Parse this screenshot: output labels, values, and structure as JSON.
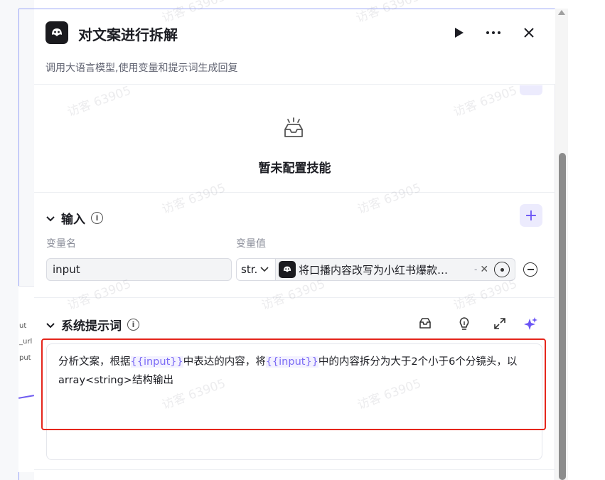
{
  "node": {
    "title": "对文案进行拆解",
    "description": "调用大语言模型,使用变量和提示词生成回复"
  },
  "skills": {
    "empty_text": "暂未配置技能"
  },
  "input_section": {
    "title": "输入",
    "col_name": "变量名",
    "col_value": "变量值",
    "rows": [
      {
        "name": "input",
        "type": "str.",
        "ref": "将口播内容改写为小红书爆款…",
        "ref_suffix": "-"
      }
    ]
  },
  "system_prompt": {
    "title": "系统提示词",
    "text_parts": [
      "分析文案，根据",
      "{{input}}",
      "中表达的内容，将",
      "{{input}}",
      "中的内容拆分为大于2个小于6个分镜头，以array<string>结构输出"
    ]
  },
  "canvas": {
    "labels": [
      "ut",
      "_url",
      "put"
    ]
  },
  "watermark": "访客 63905",
  "colors": {
    "accent": "#6b55f5",
    "highlight_border": "#e5261c",
    "variable": "#7c6cf5"
  }
}
